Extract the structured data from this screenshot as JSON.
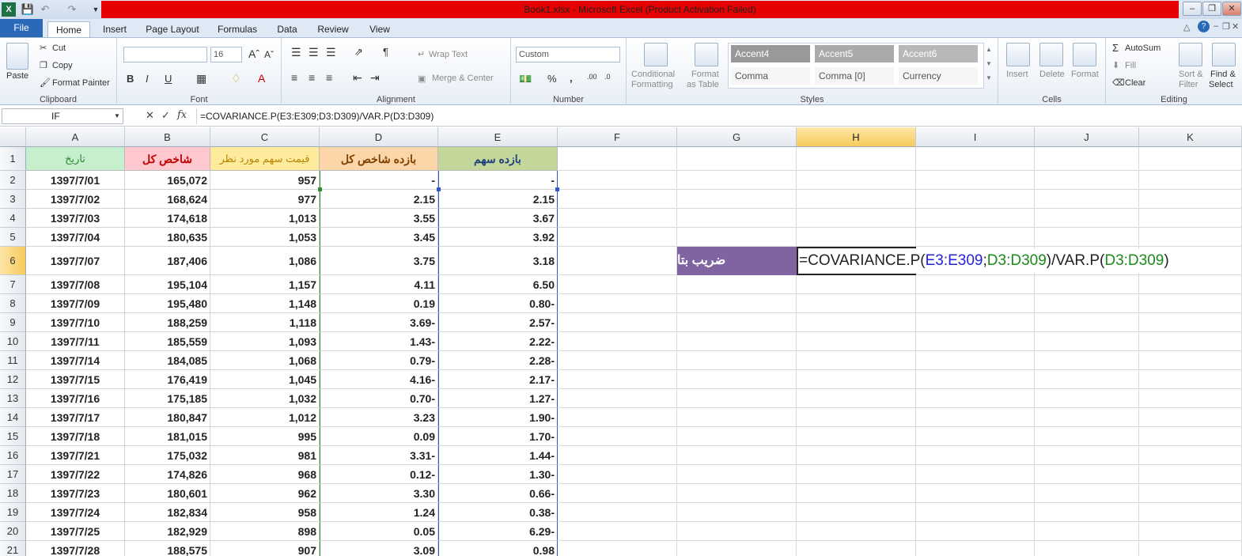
{
  "window": {
    "title": "Book1.xlsx  -  Microsoft Excel (Product Activation Failed)"
  },
  "tabs": {
    "file": "File",
    "items": [
      "Home",
      "Insert",
      "Page Layout",
      "Formulas",
      "Data",
      "Review",
      "View"
    ]
  },
  "ribbon": {
    "clipboard": {
      "label": "Clipboard",
      "paste": "Paste",
      "cut": "Cut",
      "copy": "Copy",
      "format_painter": "Format Painter"
    },
    "font": {
      "label": "Font",
      "size": "16",
      "bold": "B",
      "italic": "I",
      "underline": "U"
    },
    "alignment": {
      "label": "Alignment",
      "wrap": "Wrap Text",
      "merge": "Merge & Center"
    },
    "number": {
      "label": "Number",
      "format": "Custom",
      "percent": "%",
      "comma": ","
    },
    "styles": {
      "label": "Styles",
      "conditional": "Conditional",
      "conditional2": "Formatting",
      "format_table": "Format",
      "format_table2": "as Table",
      "cells": [
        "Accent4",
        "Accent5",
        "Accent6",
        "Comma",
        "Comma [0]",
        "Currency"
      ]
    },
    "cells": {
      "label": "Cells",
      "insert": "Insert",
      "delete": "Delete",
      "format": "Format"
    },
    "editing": {
      "label": "Editing",
      "autosum": "AutoSum",
      "fill": "Fill",
      "clear": "Clear",
      "sort": "Sort &",
      "sort2": "Filter",
      "find": "Find &",
      "find2": "Select"
    },
    "colors": {
      "accent4": "#8064a2",
      "accent5": "#4bacc6",
      "accent6": "#f79646"
    }
  },
  "formula_bar": {
    "name_box": "IF",
    "fx": "fx",
    "formula": "=COVARIANCE.P(E3:E309;D3:D309)/VAR.P(D3:D309)"
  },
  "columns": [
    "A",
    "B",
    "C",
    "D",
    "E",
    "F",
    "G",
    "H",
    "I",
    "J",
    "K"
  ],
  "selected_column": "H",
  "selected_row": "6",
  "headers": {
    "A": "تاریخ",
    "B": "شاخص کل",
    "C": "قیمت سهم مورد نظر",
    "D": "بازده شاخص کل",
    "E": "بازده سهم"
  },
  "header_colors": {
    "A": {
      "bg": "#c6efce",
      "fg": "#2e8b2e"
    },
    "B": {
      "bg": "#ffc7ce",
      "fg": "#c00000"
    },
    "C": {
      "bg": "#ffeb9c",
      "fg": "#b8860b"
    },
    "D": {
      "bg": "#fcd5a8",
      "fg": "#7f3f00"
    },
    "E": {
      "bg": "#c4d79b",
      "fg": "#1f3f7f"
    }
  },
  "rows": [
    {
      "n": "2",
      "A": "1397/7/01",
      "B": "165,072",
      "C": "957",
      "D": "-",
      "E": "-"
    },
    {
      "n": "3",
      "A": "1397/7/02",
      "B": "168,624",
      "C": "977",
      "D": "2.15",
      "E": "2.15"
    },
    {
      "n": "4",
      "A": "1397/7/03",
      "B": "174,618",
      "C": "1,013",
      "D": "3.55",
      "E": "3.67"
    },
    {
      "n": "5",
      "A": "1397/7/04",
      "B": "180,635",
      "C": "1,053",
      "D": "3.45",
      "E": "3.92"
    },
    {
      "n": "6",
      "A": "1397/7/07",
      "B": "187,406",
      "C": "1,086",
      "D": "3.75",
      "E": "3.18"
    },
    {
      "n": "7",
      "A": "1397/7/08",
      "B": "195,104",
      "C": "1,157",
      "D": "4.11",
      "E": "6.50"
    },
    {
      "n": "8",
      "A": "1397/7/09",
      "B": "195,480",
      "C": "1,148",
      "D": "0.19",
      "E": "0.80-"
    },
    {
      "n": "9",
      "A": "1397/7/10",
      "B": "188,259",
      "C": "1,118",
      "D": "3.69-",
      "E": "2.57-"
    },
    {
      "n": "10",
      "A": "1397/7/11",
      "B": "185,559",
      "C": "1,093",
      "D": "1.43-",
      "E": "2.22-"
    },
    {
      "n": "11",
      "A": "1397/7/14",
      "B": "184,085",
      "C": "1,068",
      "D": "0.79-",
      "E": "2.28-"
    },
    {
      "n": "12",
      "A": "1397/7/15",
      "B": "176,419",
      "C": "1,045",
      "D": "4.16-",
      "E": "2.17-"
    },
    {
      "n": "13",
      "A": "1397/7/16",
      "B": "175,185",
      "C": "1,032",
      "D": "0.70-",
      "E": "1.27-"
    },
    {
      "n": "14",
      "A": "1397/7/17",
      "B": "180,847",
      "C": "1,012",
      "D": "3.23",
      "E": "1.90-"
    },
    {
      "n": "15",
      "A": "1397/7/18",
      "B": "181,015",
      "C": "995",
      "D": "0.09",
      "E": "1.70-"
    },
    {
      "n": "16",
      "A": "1397/7/21",
      "B": "175,032",
      "C": "981",
      "D": "3.31-",
      "E": "1.44-"
    },
    {
      "n": "17",
      "A": "1397/7/22",
      "B": "174,826",
      "C": "968",
      "D": "0.12-",
      "E": "1.30-"
    },
    {
      "n": "18",
      "A": "1397/7/23",
      "B": "180,601",
      "C": "962",
      "D": "3.30",
      "E": "0.66-"
    },
    {
      "n": "19",
      "A": "1397/7/24",
      "B": "182,834",
      "C": "958",
      "D": "1.24",
      "E": "0.38-"
    },
    {
      "n": "20",
      "A": "1397/7/25",
      "B": "182,929",
      "C": "898",
      "D": "0.05",
      "E": "6.29-"
    },
    {
      "n": "21",
      "A": "1397/7/28",
      "B": "188,575",
      "C": "907",
      "D": "3.09",
      "E": "0.98"
    }
  ],
  "beta_label": "ضریب بتا",
  "edit_formula": {
    "p1": "=COVARIANCE.P(",
    "p2": "E3:E309",
    "p3": ";",
    "p4": "D3:D309",
    "p5": ")/VAR.P(",
    "p6": "D3:D309",
    "p7": ")"
  }
}
